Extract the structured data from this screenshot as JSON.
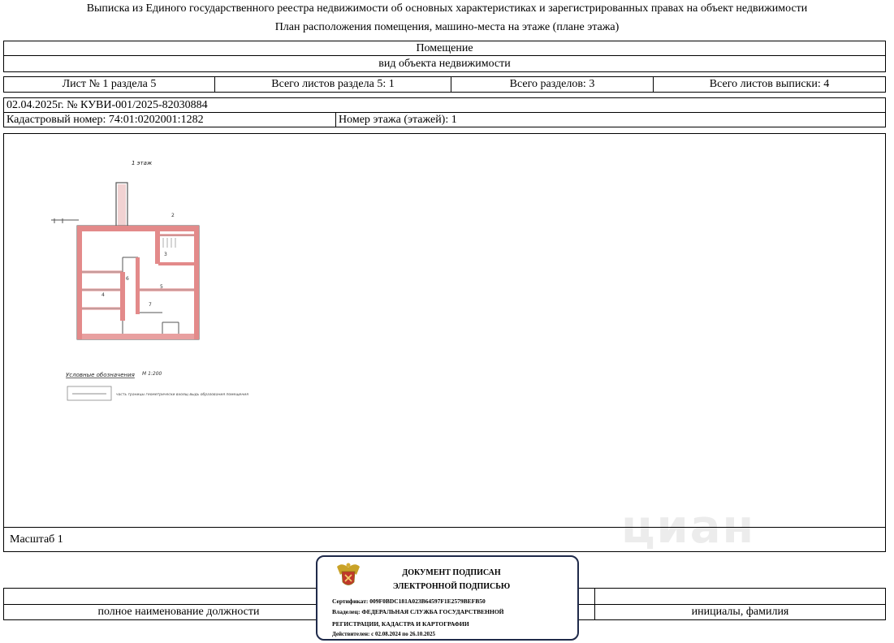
{
  "header": {
    "title": "Выписка из Единого государственного реестра недвижимости об основных характеристиках и зарегистрированных правах на объект недвижимости",
    "subtitle": "План расположения помещения, машино-места на этаже (плане этажа)"
  },
  "object": {
    "type": "Помещение",
    "type_caption": "вид объекта недвижимости"
  },
  "sheet_info": {
    "sheet": "Лист № 1 раздела 5",
    "total_sheets_section": "Всего листов раздела 5: 1",
    "total_sections": "Всего разделов: 3",
    "total_sheets_extract": "Всего листов выписки: 4"
  },
  "doc_date_number": "02.04.2025г. № КУВИ-001/2025-82030884",
  "cadastral_number": "Кадастровый номер: 74:01:0202001:1282",
  "floor_number": "Номер этажа (этажей): 1",
  "plan": {
    "floor_label": "1 этаж",
    "legend_title": "Условные обозначения",
    "scale_note": "М 1:200",
    "legend_text": "часть границы геометрически вхоящ выдь образования помещения",
    "room_labels": [
      "2",
      "3",
      "4",
      "5",
      "6",
      "7"
    ]
  },
  "scale": "Масштаб 1",
  "signature": {
    "position_caption": "полное наименование должности",
    "name_caption": "инициалы, фамилия"
  },
  "stamp": {
    "line1": "ДОКУМЕНТ ПОДПИСАН",
    "line2": "ЭЛЕКТРОННОЙ ПОДПИСЬЮ",
    "certificate": "Сертификат: 009F0BDC181A023B64597F1E2579BEFB50",
    "owner_line1": "Владелец: ФЕДЕРАЛЬНАЯ СЛУЖБА ГОСУДАРСТВЕННОЙ",
    "owner_line2": "РЕГИСТРАЦИИ, КАДАСТРА И КАРТОГРАФИИ",
    "validity": "Действителен: с 02.08.2024 по 26.10.2025"
  },
  "watermark": "циан",
  "colors": {
    "wall_red": "#e38a8a",
    "stamp_border": "#1f2a4a",
    "watermark": "#e6e6e6"
  }
}
